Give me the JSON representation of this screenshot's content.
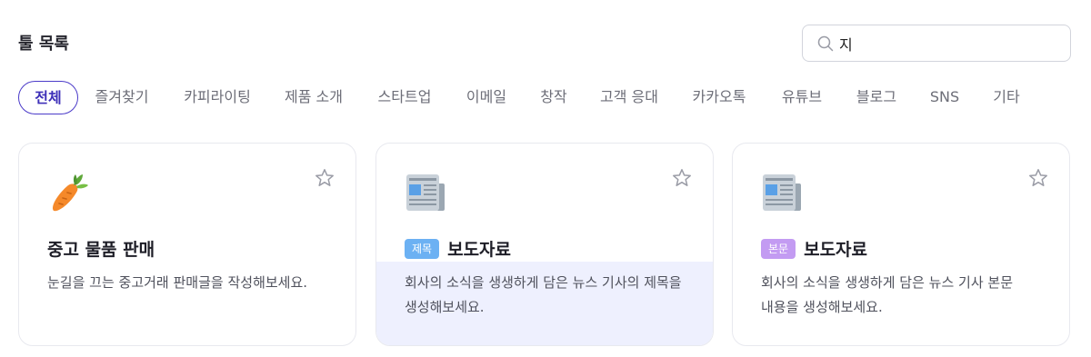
{
  "header": {
    "title": "툴 목록"
  },
  "search": {
    "value": "지",
    "placeholder": ""
  },
  "categories": [
    {
      "label": "전체",
      "active": true
    },
    {
      "label": "즐겨찾기",
      "active": false
    },
    {
      "label": "카피라이팅",
      "active": false
    },
    {
      "label": "제품 소개",
      "active": false
    },
    {
      "label": "스타트업",
      "active": false
    },
    {
      "label": "이메일",
      "active": false
    },
    {
      "label": "창작",
      "active": false
    },
    {
      "label": "고객 응대",
      "active": false
    },
    {
      "label": "카카오톡",
      "active": false
    },
    {
      "label": "유튜브",
      "active": false
    },
    {
      "label": "블로그",
      "active": false
    },
    {
      "label": "SNS",
      "active": false
    },
    {
      "label": "기타",
      "active": false
    }
  ],
  "cards": [
    {
      "icon": "carrot-icon",
      "badge": "",
      "title": "중고 물품 판매",
      "description": "눈길을 끄는 중고거래 판매글을 작성해보세요.",
      "highlighted": false,
      "favorited": false
    },
    {
      "icon": "newspaper-icon",
      "badge": "제목",
      "badge_color": "#6cb1f3",
      "title": "보도자료",
      "description": "회사의 소식을 생생하게 담은 뉴스 기사의 제목을 생성해보세요.",
      "highlighted": true,
      "favorited": false
    },
    {
      "icon": "newspaper-icon",
      "badge": "본문",
      "badge_color": "#c39bf2",
      "title": "보도자료",
      "description": "회사의 소식을 생생하게 담은 뉴스 기사 본문 내용을 생성해보세요.",
      "highlighted": false,
      "favorited": false
    }
  ],
  "colors": {
    "accent": "#4b3bc9",
    "highlight_bg": "#eef0fe"
  }
}
